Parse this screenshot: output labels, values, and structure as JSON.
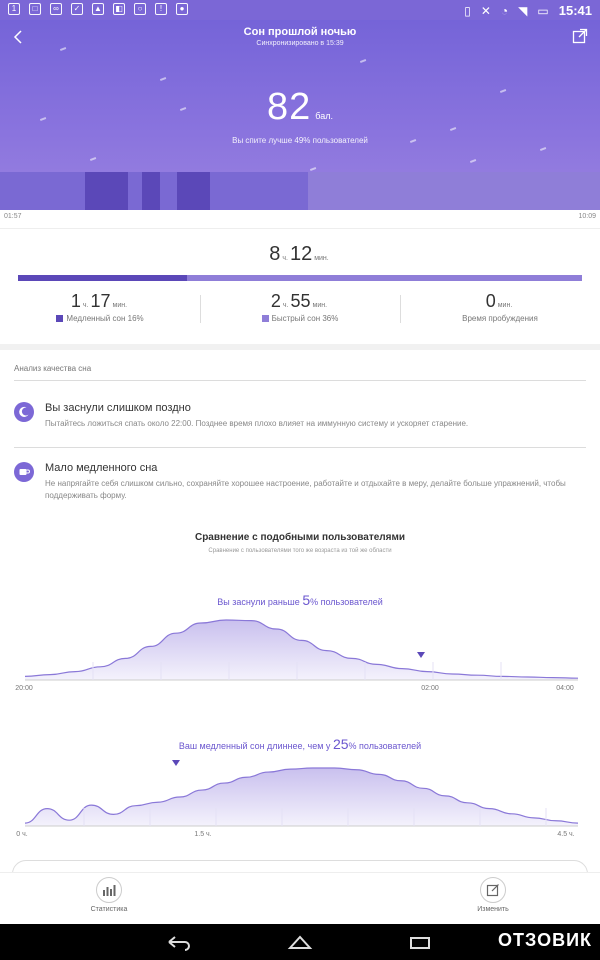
{
  "status_bar": {
    "time": "15:41"
  },
  "header": {
    "title": "Сон прошлой ночью",
    "subtitle": "Синхронизировано в 15:39",
    "score": "82",
    "score_unit": "бал.",
    "score_text": "Вы спите лучше 49% пользователей"
  },
  "timeline": {
    "start": "01:57",
    "end": "10:09"
  },
  "summary": {
    "total_hours": "8",
    "hours_unit": "ч.",
    "total_minutes": "12",
    "minutes_unit": "мин.",
    "deep_fraction": 0.3,
    "deep": {
      "hours": "1",
      "minutes": "17",
      "label": "Медленный сон 16%",
      "color": "#5b48b8"
    },
    "light": {
      "hours": "2",
      "minutes": "55",
      "label": "Быстрый сон 36%",
      "color": "#8f7ed8"
    },
    "awake": {
      "minutes": "0",
      "label": "Время пробуждения"
    }
  },
  "analysis": {
    "section_title": "Анализ качества сна",
    "tips": [
      {
        "title": "Вы заснули слишком поздно",
        "text": "Пытайтесь ложиться спать около 22:00. Позднее время плохо влияет на иммунную систему и ускоряет старение."
      },
      {
        "title": "Мало медленного сна",
        "text": "Не напрягайте себя слишком сильно, сохраняйте хорошее настроение, работайте и отдыхайте в меру, делайте больше упражнений, чтобы поддерживать форму."
      }
    ]
  },
  "comparison": {
    "title": "Сравнение с подобными пользователями",
    "subtitle": "Сравнение с пользователями того же возраста из той же области",
    "chart1_prefix": "Вы заснули раньше",
    "chart1_value": "5",
    "chart1_suffix": "% пользователей",
    "chart2_prefix": "Ваш медленный сон длиннее, чем у",
    "chart2_value": "25",
    "chart2_suffix": "% пользователей"
  },
  "chart_data": [
    {
      "type": "area",
      "title": "Вы заснули раньше 5% пользователей",
      "x_tick_labels": [
        "20:00",
        "02:00",
        "04:00"
      ],
      "marker_label": "02:00",
      "y": [
        0.06,
        0.09,
        0.14,
        0.22,
        0.36,
        0.56,
        0.78,
        0.95,
        1.0,
        0.99,
        0.85,
        0.66,
        0.49,
        0.36,
        0.26,
        0.19,
        0.14,
        0.1,
        0.08,
        0.06,
        0.05,
        0.04,
        0.03
      ]
    },
    {
      "type": "area",
      "title": "Ваш медленный сон длиннее, чем у 25% пользователей",
      "x_tick_labels": [
        "0 ч.",
        "1.5 ч.",
        "4.5 ч."
      ],
      "y": [
        0.05,
        0.3,
        0.1,
        0.36,
        0.2,
        0.35,
        0.41,
        0.5,
        0.62,
        0.74,
        0.84,
        0.93,
        0.98,
        1.0,
        1.0,
        0.97,
        0.89,
        0.78,
        0.65,
        0.52,
        0.4,
        0.3,
        0.21,
        0.14,
        0.09,
        0.05
      ]
    }
  ],
  "tabs": {
    "stats": "Статистика",
    "edit": "Изменить"
  },
  "watermark": "ОТЗОВИК"
}
